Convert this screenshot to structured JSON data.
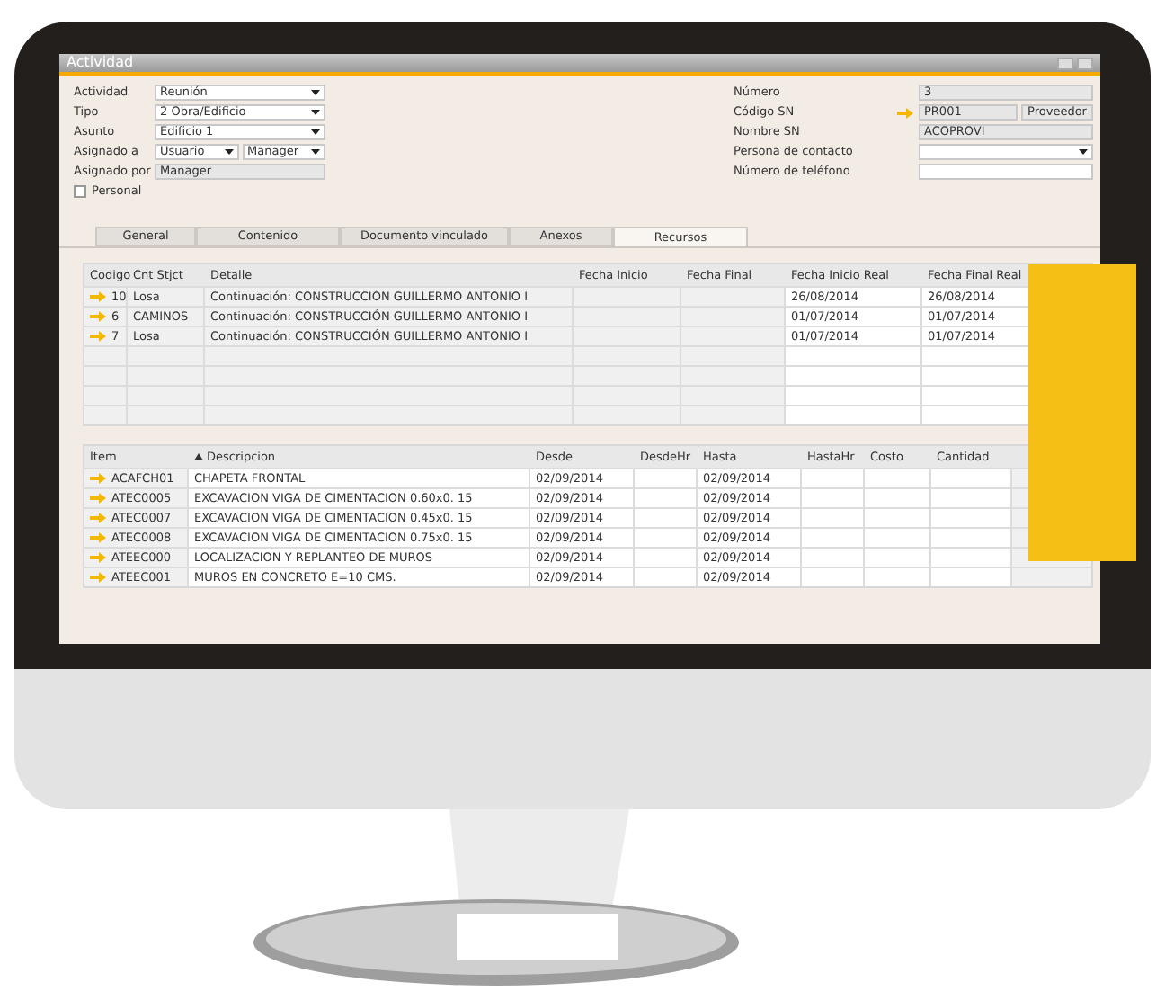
{
  "window": {
    "title": "Actividad"
  },
  "left_fields": [
    {
      "label": "Actividad",
      "kind": "dropdown",
      "value": "Reunión"
    },
    {
      "label": "Tipo",
      "kind": "dropdown",
      "value": "2 Obra/Edificio"
    },
    {
      "label": "Asunto",
      "kind": "dropdown",
      "value": "Edificio 1"
    },
    {
      "label": "Asignado a",
      "kind": "double",
      "value": "Usuario",
      "value_2": "Manager"
    },
    {
      "label": "Asignado por",
      "kind": "readonly",
      "value": "Manager"
    }
  ],
  "personal": {
    "label": "Personal",
    "checked": false
  },
  "right_fields": [
    {
      "label": "Número",
      "kind": "readonly",
      "value": "3"
    },
    {
      "label": "Código SN",
      "kind": "link",
      "value": "PR001",
      "button": "Proveedor"
    },
    {
      "label": "Nombre SN",
      "kind": "readonly",
      "value": "ACOPROVI"
    },
    {
      "label": "Persona de contacto",
      "kind": "dropdown"
    },
    {
      "label": "Número de teléfono",
      "kind": "text"
    }
  ],
  "tabs": [
    {
      "label": "General",
      "selected": false
    },
    {
      "label": "Contenido",
      "selected": false
    },
    {
      "label": "Documento vinculado",
      "selected": false
    },
    {
      "label": "Anexos",
      "selected": false
    },
    {
      "label": "Recursos",
      "selected": true
    }
  ],
  "resources_table": {
    "columns": [
      "Codigo",
      "Cnt Stjct",
      "Detalle",
      "Fecha Inicio",
      "Fecha Final",
      "Fecha Inicio Real",
      "Fecha Final Real"
    ],
    "rows": [
      {
        "cells": [
          "10",
          "Losa",
          "Continuación: CONSTRUCCIÓN GUILLERMO ANTONIO I",
          null,
          null,
          "26/08/2014",
          "26/08/2014"
        ]
      },
      {
        "cells": [
          "6",
          "CAMINOS",
          "Continuación: CONSTRUCCIÓN GUILLERMO ANTONIO I",
          null,
          null,
          "01/07/2014",
          "01/07/2014"
        ]
      },
      {
        "cells": [
          "7",
          "Losa",
          "Continuación: CONSTRUCCIÓN GUILLERMO ANTONIO I",
          null,
          null,
          "01/07/2014",
          "01/07/2014"
        ]
      }
    ]
  },
  "items_table": {
    "columns": [
      "Item",
      "Descripcion",
      "Desde",
      "DesdeHr",
      "Hasta",
      "HastaHr",
      "Costo",
      "Cantidad"
    ],
    "rows": [
      {
        "cells": [
          "ACAFCH01",
          "CHAPETA FRONTAL",
          "02/09/2014",
          null,
          "02/09/2014",
          null,
          null,
          null
        ]
      },
      {
        "cells": [
          "ATEC0005",
          "EXCAVACION VIGA DE CIMENTACION 0.60x0. 15",
          "02/09/2014",
          null,
          "02/09/2014",
          null,
          null,
          null
        ]
      },
      {
        "cells": [
          "ATEC0007",
          "EXCAVACION VIGA DE CIMENTACION 0.45x0. 15",
          "02/09/2014",
          null,
          "02/09/2014",
          null,
          null,
          null
        ]
      },
      {
        "cells": [
          "ATEC0008",
          "EXCAVACION VIGA DE CIMENTACION 0.75x0. 15",
          "02/09/2014",
          null,
          "02/09/2014",
          null,
          null,
          null
        ]
      },
      {
        "cells": [
          "ATEEC000",
          "LOCALIZACION Y REPLANTEO DE MUROS",
          "02/09/2014",
          null,
          "02/09/2014",
          null,
          null,
          null
        ]
      },
      {
        "cells": [
          "ATEEC001",
          "MUROS EN CONCRETO E=10 CMS.",
          "02/09/2014",
          null,
          "02/09/2014",
          null,
          null,
          null
        ]
      }
    ]
  }
}
